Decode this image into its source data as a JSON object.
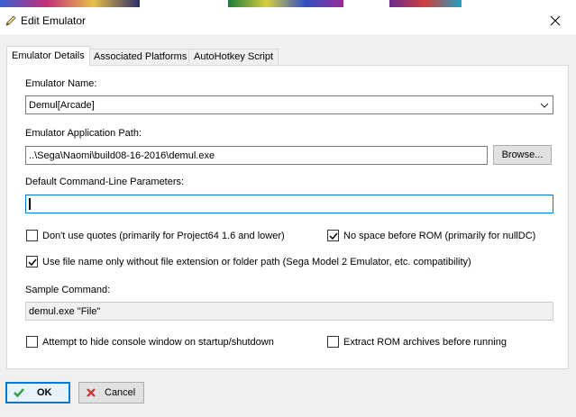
{
  "window": {
    "title": "Edit Emulator"
  },
  "tabs": [
    {
      "label": "Emulator Details",
      "active": true
    },
    {
      "label": "Associated Platforms",
      "active": false
    },
    {
      "label": "AutoHotkey Script",
      "active": false
    }
  ],
  "form": {
    "emulator_name_label": "Emulator Name:",
    "emulator_name_value": "Demul[Arcade]",
    "app_path_label": "Emulator Application Path:",
    "app_path_value": "..\\Sega\\Naomi\\build08-16-2016\\demul.exe",
    "browse_label": "Browse...",
    "cmdline_label": "Default Command-Line Parameters:",
    "cmdline_value": "",
    "sample_label": "Sample Command:",
    "sample_value": "demul.exe \"File\""
  },
  "options": {
    "dont_use_quotes": {
      "label": "Don't use quotes (primarily for Project64 1.6 and lower)",
      "checked": false
    },
    "no_space_before_rom": {
      "label": "No space before ROM (primarily for nullDC)",
      "checked": true
    },
    "file_name_only": {
      "label": "Use file name only without file extension or folder path (Sega Model 2 Emulator, etc. compatibility)",
      "checked": true
    },
    "hide_console": {
      "label": "Attempt to hide console window on startup/shutdown",
      "checked": false
    },
    "extract_rom": {
      "label": "Extract ROM archives before running",
      "checked": false
    }
  },
  "footer": {
    "ok_label": "OK",
    "cancel_label": "Cancel"
  },
  "colors": {
    "accent": "#0078d7",
    "ok_check": "#2e9e3e",
    "cancel_x": "#d32f2f"
  }
}
